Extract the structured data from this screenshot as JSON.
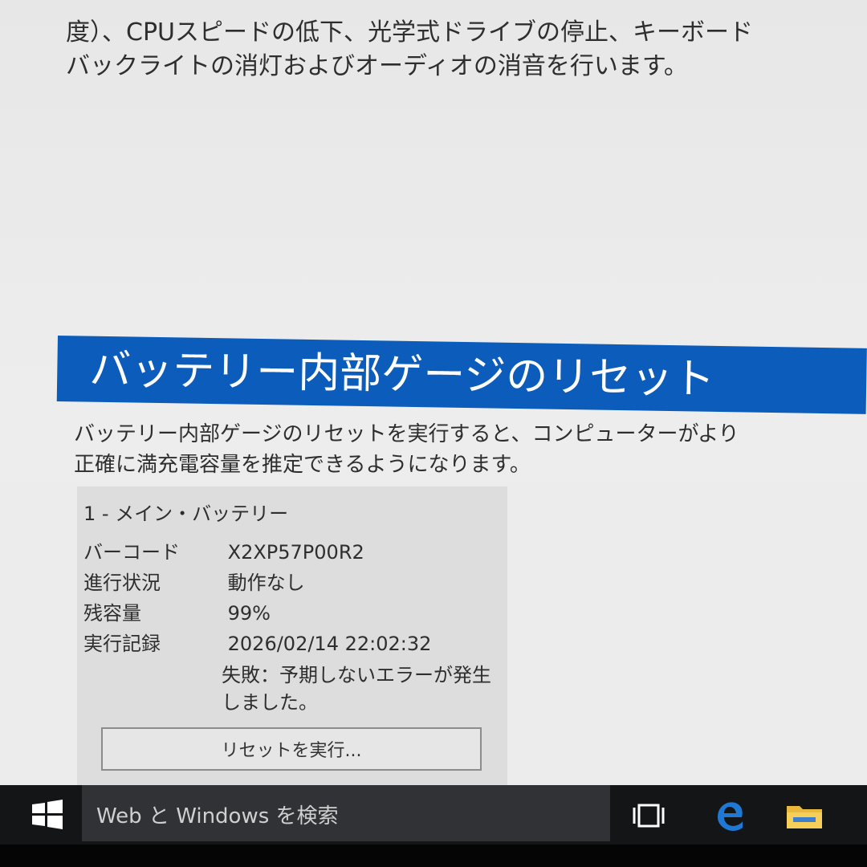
{
  "intro": {
    "line1": "度）、CPUスピードの低下、光学式ドライブの停止、キーボード",
    "line2": "バックライトの消灯およびオーディオの消音を行います。"
  },
  "section": {
    "title": "バッテリー内部ゲージのリセット",
    "desc_line1": "バッテリー内部ゲージのリセットを実行すると、コンピューターがより",
    "desc_line2": "正確に満充電容量を推定できるようになります。"
  },
  "battery": {
    "title": "1 - メイン・バッテリー",
    "rows": [
      {
        "label": "バーコード",
        "value": "X2XP57P00R2"
      },
      {
        "label": "進行状況",
        "value": "動作なし"
      },
      {
        "label": "残容量",
        "value": "99%"
      },
      {
        "label": "実行記録",
        "value": "2026/02/14 22:02:32"
      }
    ],
    "message_line1": "失敗：予期しないエラーが発生",
    "message_line2": "しました。",
    "reset_button": "リセットを実行..."
  },
  "taskbar": {
    "search_text": "Web と Windows を検索",
    "icons": [
      "windows-start-icon",
      "task-view-icon",
      "edge-icon",
      "file-explorer-icon"
    ],
    "colors": {
      "background": "#141517",
      "search": "#303236",
      "accent": "#0c5cbc"
    }
  }
}
